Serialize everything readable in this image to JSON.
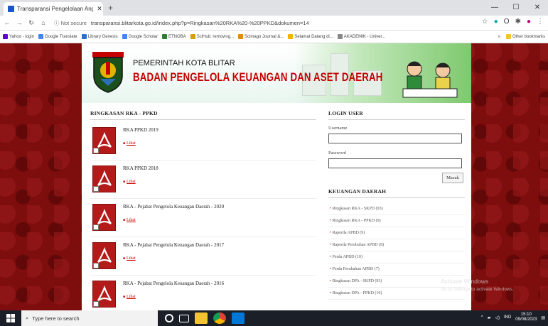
{
  "browser": {
    "tab_title": "Transparansi Pengelolaan Anggar",
    "address_security": "Not secure",
    "url": "transparansi.blitarkota.go.id/index.php?p=Ringkasan%20RKA%20-%20PPKD&dokumen=14",
    "bookmarks": [
      "Yahoo - login",
      "Google Translate",
      "Library Genesis",
      "Google Scholar",
      "ETNOBA",
      "SciHub: removing...",
      "Scimago Journal &...",
      "Selamat Datang di...",
      "AKADEMIK - Univer..."
    ],
    "other_bookmarks": "Other bookmarks",
    "bookmark_overflow": "»"
  },
  "site": {
    "title": "PEMERINTAH KOTA BLITAR",
    "subtitle": "BADAN PENGELOLA KEUANGAN DAN ASET DAERAH",
    "logo_text": "KOTA BLITAR"
  },
  "main": {
    "section_title": "RINGKASAN RKA - PPKD",
    "documents": [
      {
        "title": "RKA PPKD 2019",
        "link": "Lihat"
      },
      {
        "title": "RKA PPKD 2018",
        "link": "Lihat"
      },
      {
        "title": "RKA - Pejabat Pengelola Keuangan Daerah - 2020",
        "link": "Lihat"
      },
      {
        "title": "RKA - Pejabat Pengelola Keuangan Daerah - 2017",
        "link": "Lihat"
      },
      {
        "title": "RKA - Pejabat Pengelola Keuangan Daerah - 2016",
        "link": "Lihat"
      }
    ]
  },
  "sidebar": {
    "login_title": "LOGIN USER",
    "username_label": "Username",
    "password_label": "Password",
    "login_button": "Masuk",
    "keuangan_title": "KEUANGAN DAERAH",
    "items": [
      "Ringkasan RKA - SKPD (93)",
      "Ringkasan RKA - PPKD (9)",
      "Raperda APBD (9)",
      "Raperda Perubahan APBD (8)",
      "Perda APBD (10)",
      "Perda Perubahan APBD (7)",
      "Ringkasan DPA - SKPD (93)",
      "Ringkasan DPA - PPKD (10)"
    ]
  },
  "windows": {
    "activate_title": "Activate Windows",
    "activate_sub": "Go to Settings to activate Windows.",
    "search_placeholder": "Type here to search",
    "language": "IND",
    "time": "15:10",
    "date": "09/08/2023"
  }
}
